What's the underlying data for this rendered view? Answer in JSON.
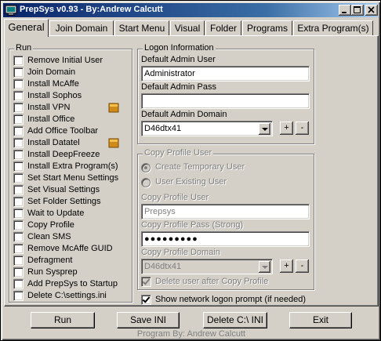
{
  "window": {
    "title": "PrepSys v0.93 - By:Andrew Calcutt"
  },
  "tabs": [
    {
      "label": "General",
      "active": true
    },
    {
      "label": "Join Domain"
    },
    {
      "label": "Start Menu"
    },
    {
      "label": "Visual"
    },
    {
      "label": "Folder"
    },
    {
      "label": "Programs"
    },
    {
      "label": "Extra Program(s)"
    }
  ],
  "run": {
    "title": "Run",
    "items": [
      {
        "label": "Remove Initial User",
        "checked": false
      },
      {
        "label": "Join Domain",
        "checked": false
      },
      {
        "label": "Install McAffe",
        "checked": false
      },
      {
        "label": "Install Sophos",
        "checked": false
      },
      {
        "label": "Install VPN",
        "checked": false,
        "icon": "settings-folder-icon"
      },
      {
        "label": "Install Office",
        "checked": false
      },
      {
        "label": "Add Office Toolbar",
        "checked": false
      },
      {
        "label": "Install Datatel",
        "checked": false,
        "icon": "settings-folder-icon"
      },
      {
        "label": "Install DeepFreeze",
        "checked": false
      },
      {
        "label": "Install Extra Program(s)",
        "checked": false
      },
      {
        "label": "Set Start Menu Settings",
        "checked": false
      },
      {
        "label": "Set Visual Settings",
        "checked": false
      },
      {
        "label": "Set Folder Settings",
        "checked": false
      },
      {
        "label": "Wait to Update",
        "checked": false
      },
      {
        "label": "Copy Profile",
        "checked": false
      },
      {
        "label": "Clean SMS",
        "checked": false
      },
      {
        "label": "Remove McAffe GUID",
        "checked": false
      },
      {
        "label": "Defragment",
        "checked": false
      },
      {
        "label": "Run Sysprep",
        "checked": false
      },
      {
        "label": "Add PrepSys to Startup",
        "checked": false
      },
      {
        "label": "Delete C:\\settings.ini",
        "checked": false
      }
    ]
  },
  "logon": {
    "title": "Logon Information",
    "admin_user_label": "Default Admin User",
    "admin_user_value": "Administrator",
    "admin_pass_label": "Default Admin Pass",
    "admin_pass_value": "",
    "admin_domain_label": "Default Admin Domain",
    "admin_domain_value": "D46dtx41",
    "plus_label": "+",
    "minus_label": "-"
  },
  "copy_profile": {
    "title": "Copy Profile User",
    "radio_create": "Create Temporary User",
    "radio_existing": "User Existing User",
    "user_label": "Copy Profile User",
    "user_value": "Prepsys",
    "pass_label": "Copy Profile Pass (Strong)",
    "pass_value": "●●●●●●●●●",
    "domain_label": "Copy Profile Domain",
    "domain_value": "D46dtx41",
    "plus_label": "+",
    "minus_label": "-",
    "delete_after_label": "Delete user after Copy Profile",
    "delete_after_checked": true
  },
  "network_prompt": {
    "label": "Show network logon prompt (if needed)",
    "checked": true
  },
  "buttons": {
    "run": "Run",
    "save_ini": "Save INI",
    "delete_ini": "Delete C:\\ INI",
    "exit": "Exit"
  },
  "footer": "Program By: Andrew Calcutt"
}
